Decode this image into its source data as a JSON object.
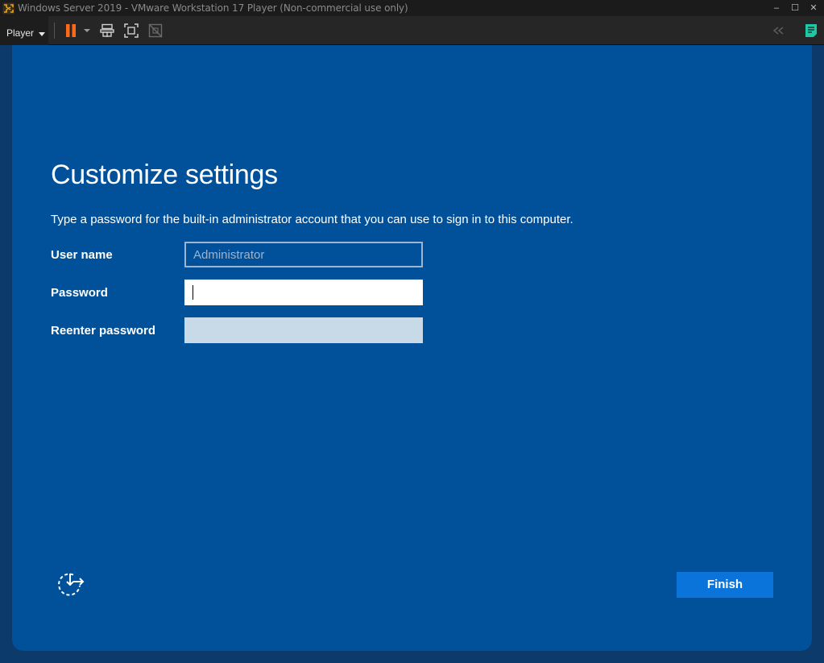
{
  "window": {
    "title": "Windows Server 2019 - VMware Workstation 17 Player (Non-commercial use only)",
    "minimize_glyph": "–",
    "maximize_glyph": "☐",
    "close_glyph": "✕"
  },
  "toolbar": {
    "player_label": "Player",
    "icons": [
      "pause-icon",
      "send-ctrl-alt-del-icon",
      "full-screen-icon",
      "unity-icon",
      "back-icon",
      "notes-icon"
    ],
    "pause_color": "#ff6a1a",
    "notes_color": "#1ec8a5"
  },
  "setup": {
    "heading": "Customize settings",
    "description": "Type a password for the built-in administrator account that you can use to sign in to this computer.",
    "username_label": "User name",
    "username_placeholder": "Administrator",
    "password_label": "Password",
    "password_value": "",
    "reenter_label": "Reenter password",
    "reenter_value": "",
    "finish_label": "Finish",
    "accent": "#0a74da",
    "background": "#00519a"
  }
}
